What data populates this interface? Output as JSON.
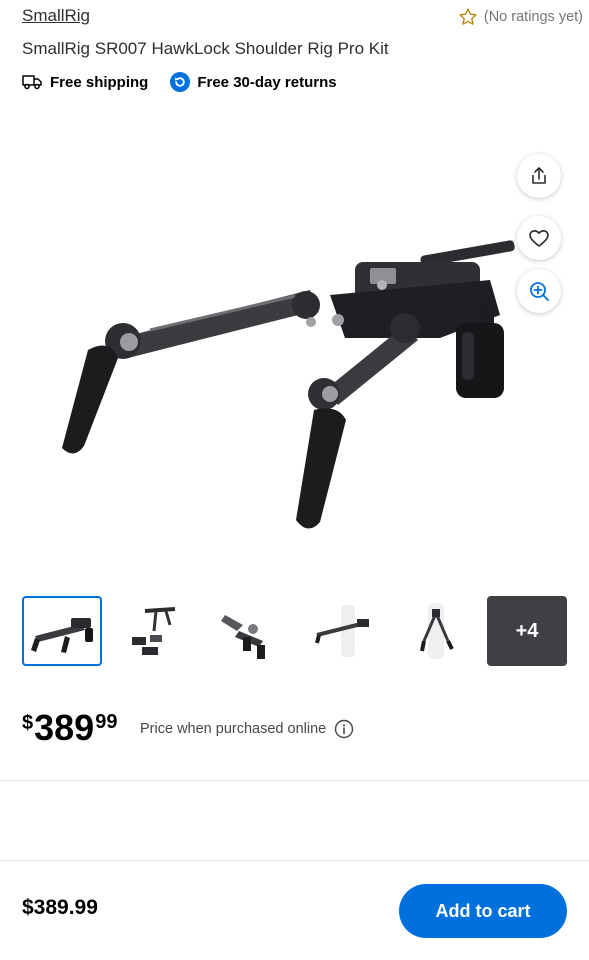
{
  "product": {
    "brand": "SmallRig",
    "rating_text": "(No ratings yet)",
    "title": "SmallRig SR007 HawkLock Shoulder Rig Pro Kit",
    "perks": [
      "Free shipping",
      "Free 30-day returns"
    ]
  },
  "gallery": {
    "more_count": "+4",
    "thumbnail_count": 6,
    "selected_index": 0
  },
  "price": {
    "currency": "$",
    "dollars": "389",
    "cents": "99",
    "note": "Price when purchased online"
  },
  "bottom_bar": {
    "price": "$389.99",
    "add_to_cart": "Add to cart"
  },
  "colors": {
    "accent": "#0071dc",
    "star": "#b8860b",
    "text": "#2e2f32"
  }
}
